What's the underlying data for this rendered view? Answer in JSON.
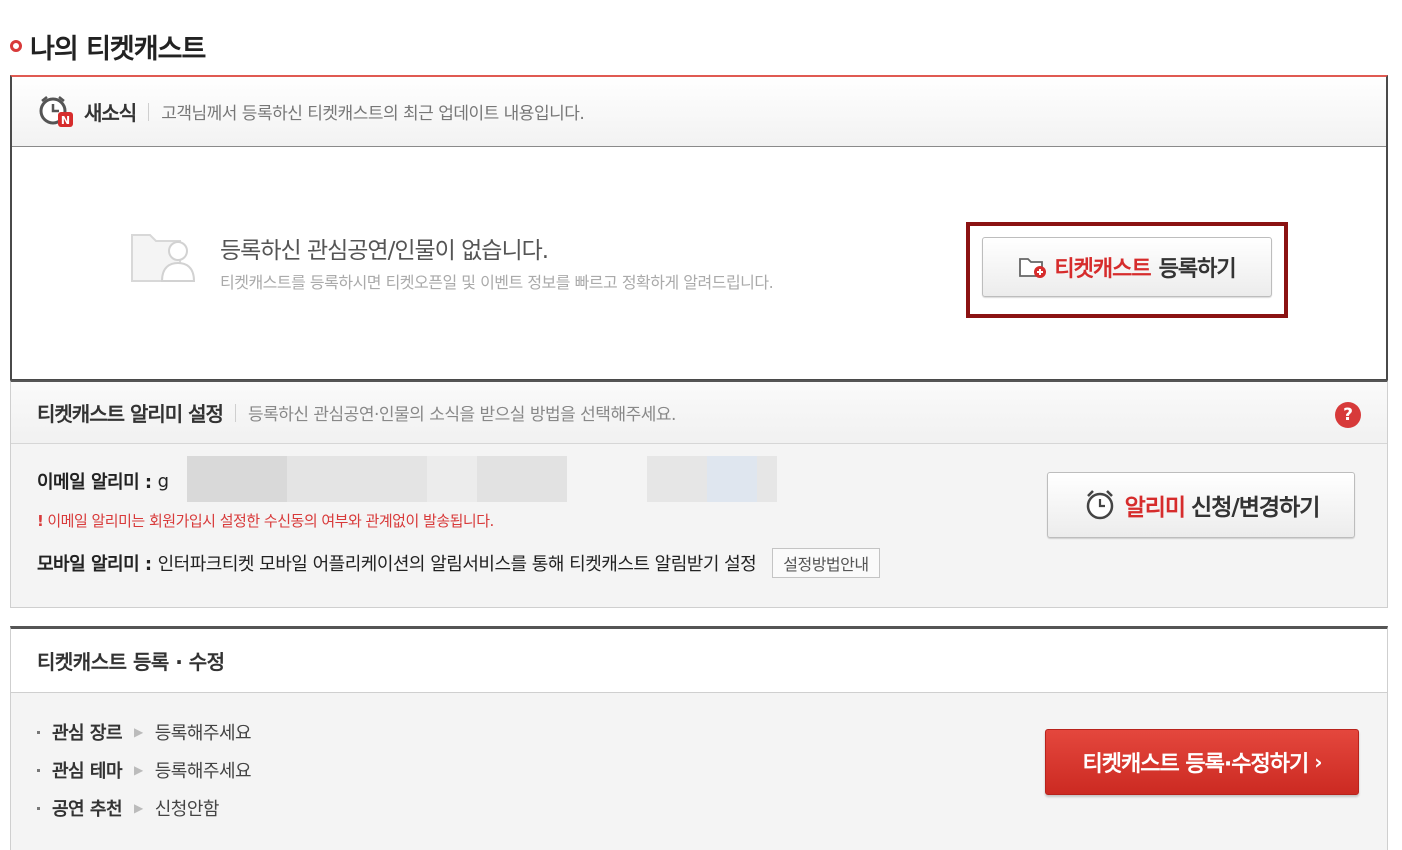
{
  "page_title": "나의 티켓캐스트",
  "news": {
    "title": "새소식",
    "description": "고객님께서 등록하신 티켓캐스트의 최근 업데이트 내용입니다.",
    "empty_title": "등록하신 관심공연/인물이 없습니다.",
    "empty_description": "티켓캐스트를 등록하시면 티켓오픈일 및 이벤트 정보를 빠르고 정확하게 알려드립니다.",
    "register_button": {
      "highlight": "티켓캐스트",
      "rest": "등록하기"
    }
  },
  "alarm": {
    "title": "티켓캐스트 알리미 설정",
    "description": "등록하신 관심공연·인물의 소식을 받으실 방법을 선택해주세요.",
    "help_icon": "?",
    "email_label": "이메일 알리미 :",
    "email_value": "g",
    "warning_mark": "!",
    "warning": "이메일 알리미는 회원가입시 설정한 수신동의 여부와 관계없이 발송됩니다.",
    "mobile_label": "모바일 알리미 :",
    "mobile_text": "인터파크티켓 모바일 어플리케이션의 알림서비스를 통해 티켓캐스트 알림받기 설정",
    "guide_button": "설정방법안내",
    "alarm_button": {
      "highlight": "알리미",
      "rest": "신청/변경하기"
    }
  },
  "register": {
    "title": "티켓캐스트 등록 · 수정",
    "items": [
      {
        "label": "관심 장르",
        "value": "등록해주세요"
      },
      {
        "label": "관심 테마",
        "value": "등록해주세요"
      },
      {
        "label": "공연 추천",
        "value": "신청안함"
      }
    ],
    "button": "티켓캐스트 등록·수정하기",
    "button_chevron": "›"
  },
  "colors": {
    "accent_red": "#d62c2c",
    "frame_dark_red": "#8b1212"
  }
}
